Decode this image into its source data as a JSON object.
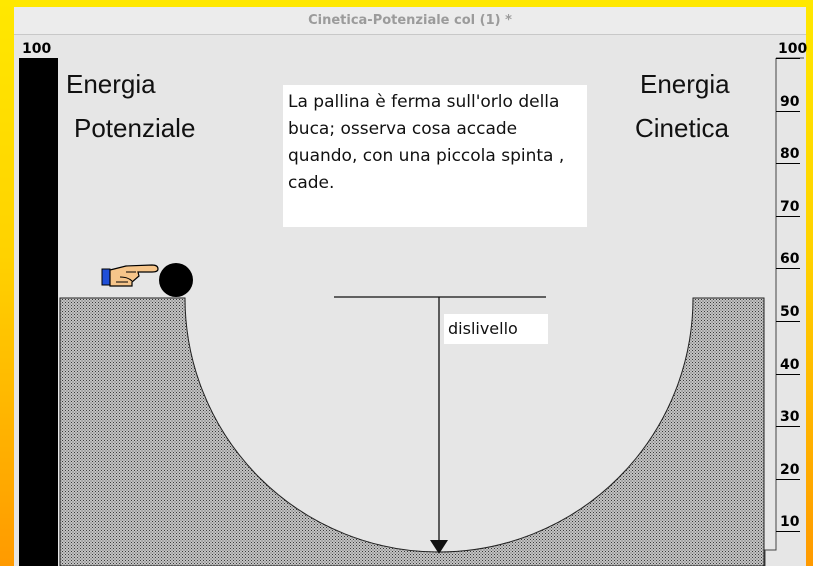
{
  "window": {
    "title": "Cinetica-Potenziale col (1) *"
  },
  "potential": {
    "label_line1": "Energia",
    "label_line2": "Potenziale",
    "top_value": "100",
    "level": 1.0
  },
  "kinetic": {
    "label_line1": "Energia",
    "label_line2": "Cinetica",
    "level": 0.0,
    "scale_ticks": [
      "100",
      "90",
      "80",
      "70",
      "60",
      "50",
      "40",
      "30",
      "20",
      "10"
    ]
  },
  "message": {
    "text": "La pallina è ferma sull'orlo della buca; osserva cosa accade quando, con una piccola spinta , cade."
  },
  "dislivello": {
    "label": "dislivello"
  },
  "icons": {
    "hand": "pointing-hand-icon",
    "ball": "ball-icon"
  },
  "colors": {
    "background": "#e6e6e6",
    "bar": "#000000",
    "ground": "#8c8c8c",
    "accent": "#ffd200"
  }
}
